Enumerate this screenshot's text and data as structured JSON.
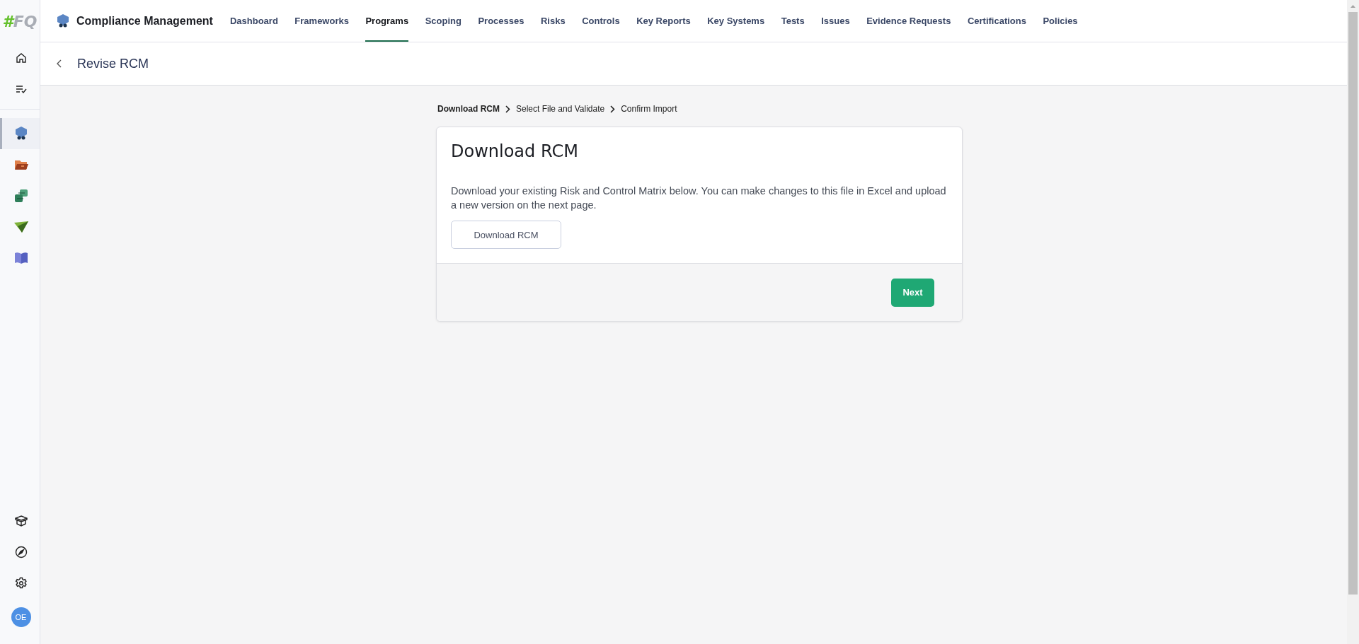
{
  "sidebar": {
    "logo": {
      "mark": "#",
      "text": "FQ"
    },
    "apps": [
      {
        "selected": true
      },
      {
        "selected": false
      },
      {
        "selected": false
      },
      {
        "selected": false
      },
      {
        "selected": false
      }
    ],
    "avatar": "OE"
  },
  "header": {
    "app_title": "Compliance Management",
    "nav": [
      {
        "label": "Dashboard",
        "selected": false
      },
      {
        "label": "Frameworks",
        "selected": false
      },
      {
        "label": "Programs",
        "selected": true
      },
      {
        "label": "Scoping",
        "selected": false
      },
      {
        "label": "Processes",
        "selected": false
      },
      {
        "label": "Risks",
        "selected": false
      },
      {
        "label": "Controls",
        "selected": false
      },
      {
        "label": "Key Reports",
        "selected": false
      },
      {
        "label": "Key Systems",
        "selected": false
      },
      {
        "label": "Tests",
        "selected": false
      },
      {
        "label": "Issues",
        "selected": false
      },
      {
        "label": "Evidence Requests",
        "selected": false
      },
      {
        "label": "Certifications",
        "selected": false
      },
      {
        "label": "Policies",
        "selected": false
      }
    ]
  },
  "page_title": "Revise RCM",
  "steps": [
    {
      "label": "Download RCM",
      "selected": true
    },
    {
      "label": "Select File and Validate",
      "selected": false
    },
    {
      "label": "Confirm Import",
      "selected": false
    }
  ],
  "card": {
    "title": "Download RCM",
    "description": "Download your existing Risk and Control Matrix below. You can make changes to this file in Excel and upload a new version on the next page.",
    "download_button": "Download RCM",
    "next_button": "Next"
  }
}
